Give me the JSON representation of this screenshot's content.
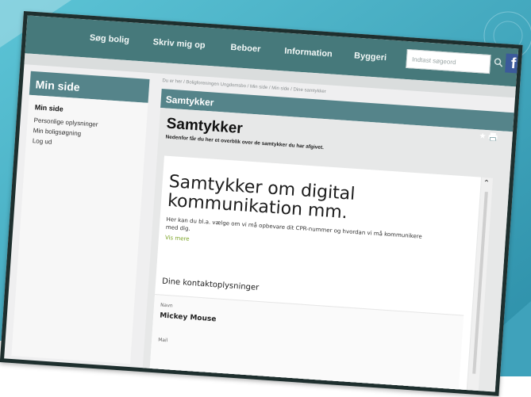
{
  "nav": {
    "items": [
      "Søg bolig",
      "Skriv mig op",
      "Beboer",
      "Information",
      "Byggeri"
    ],
    "search_placeholder": "Indtast søgeord",
    "facebook_letter": "f"
  },
  "breadcrumb": "Du er her / Boligforeningen Ungdomsbo / Min side / Min side / Dine samtykker",
  "sidebar": {
    "header": "Min side",
    "title": "Min side",
    "links": [
      "Personlige oplysninger",
      "Min boligsøgning",
      "Log ud"
    ]
  },
  "panel": {
    "header": "Samtykker",
    "icons": [
      "star-icon",
      "print-icon"
    ],
    "heading": "Samtykker",
    "subheading": "Nedenfor får du her et overblik over de samtykker du har afgivet."
  },
  "card": {
    "title": "Samtykker om digital kommunikation mm.",
    "description": "Her kan du bl.a. vælge om vi må opbevare dit CPR-nummer og hvordan vi må kommunikere med dig.",
    "link": "Vis mere",
    "section": "Dine kontaktoplysninger",
    "fields": [
      {
        "label": "Navn",
        "value": "Mickey Mouse"
      },
      {
        "label": "Mail",
        "value": ""
      }
    ]
  },
  "colors": {
    "nav": "#46797b",
    "panel_header": "#55848a",
    "frame": "#1e2f2e",
    "link": "#7aa324",
    "facebook": "#3b5a9b",
    "background_accent": "#3aa6bf"
  }
}
